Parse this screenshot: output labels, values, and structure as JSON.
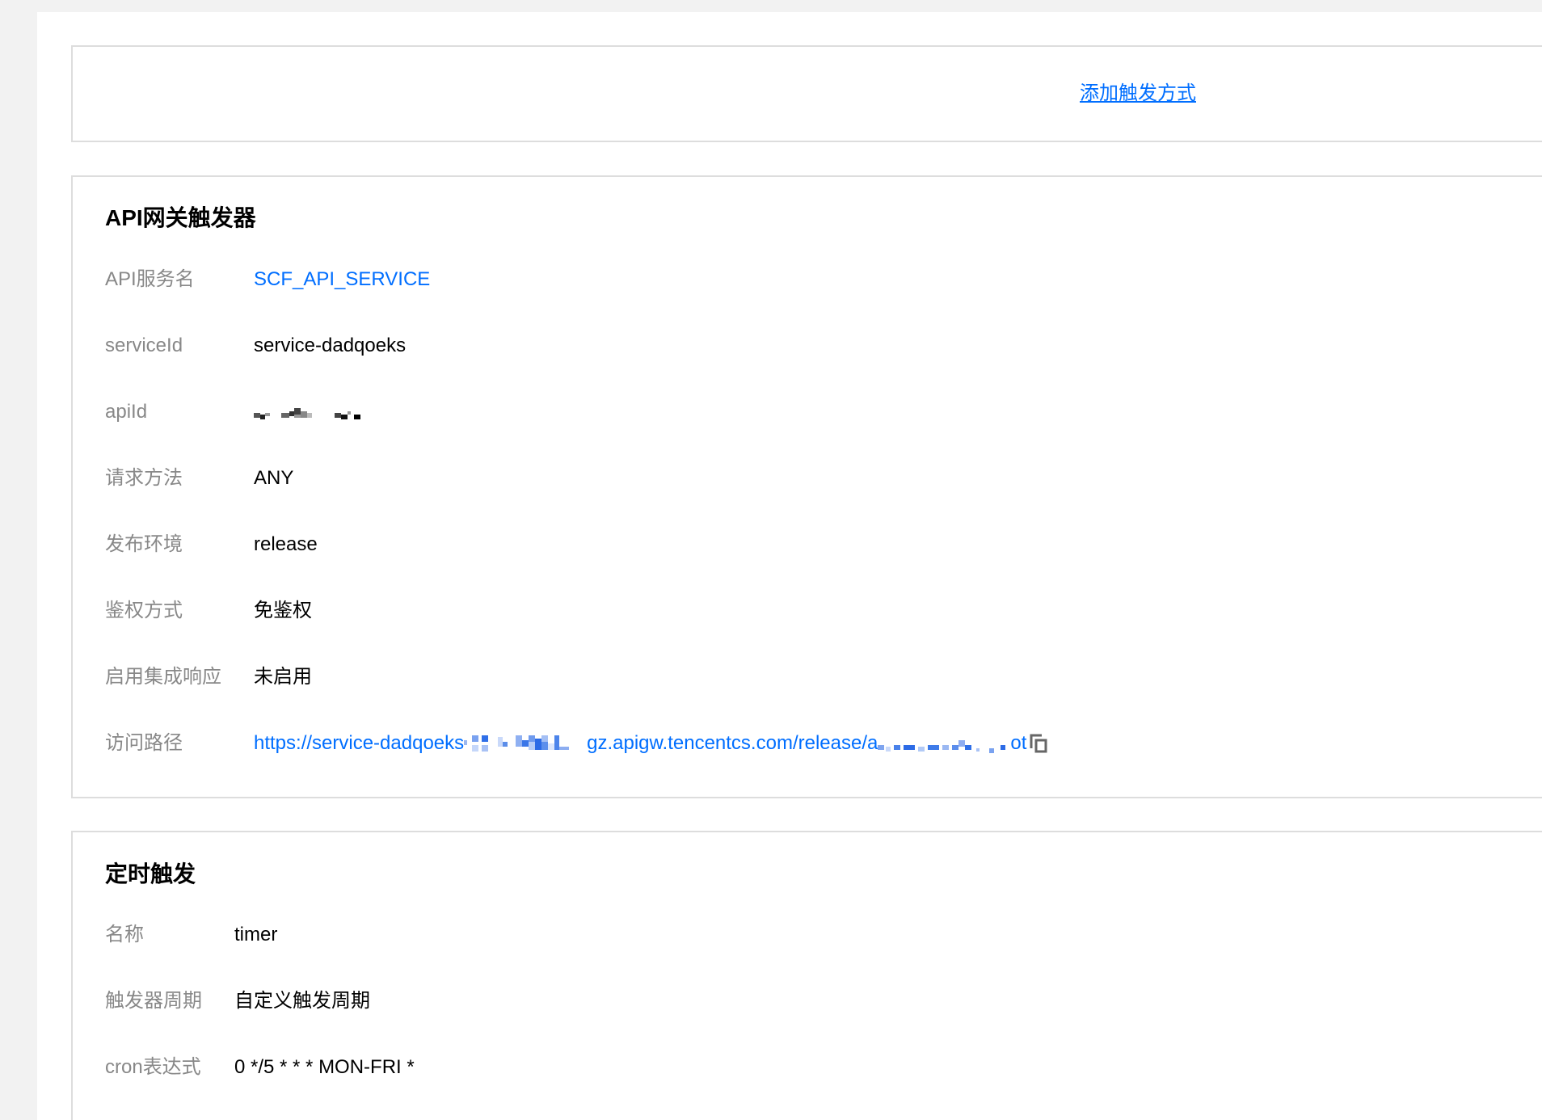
{
  "header_card": {
    "add_trigger_link": "添加触发方式"
  },
  "api_gateway_trigger": {
    "title": "API网关触发器",
    "rows": [
      {
        "label": "API服务名",
        "value": "SCF_API_SERVICE"
      },
      {
        "label": "serviceId",
        "value": "service-dadqoeks"
      },
      {
        "label": "apiId"
      },
      {
        "label": "请求方法",
        "value": "ANY"
      },
      {
        "label": "发布环境",
        "value": "release"
      },
      {
        "label": "鉴权方式",
        "value": "免鉴权"
      },
      {
        "label": "启用集成响应",
        "value": "未启用"
      },
      {
        "label": "访问路径",
        "value_parts": [
          "https://service-dadqoeks",
          "gz.apigw.tencentcs.com/release/a",
          "ot"
        ],
        "icon": "copy-icon"
      }
    ]
  },
  "timer_trigger": {
    "title": "定时触发",
    "rows": [
      {
        "label": "名称",
        "value": "timer"
      },
      {
        "label": "触发器周期",
        "value": "自定义触发周期"
      },
      {
        "label": "cron表达式",
        "value": "0 */5 * * * MON-FRI *"
      }
    ]
  },
  "colors": {
    "background": "#f2f2f2",
    "panel": "#ffffff",
    "border": "#dddddd",
    "label": "#888888",
    "value": "#000000",
    "link": "#006eff"
  }
}
